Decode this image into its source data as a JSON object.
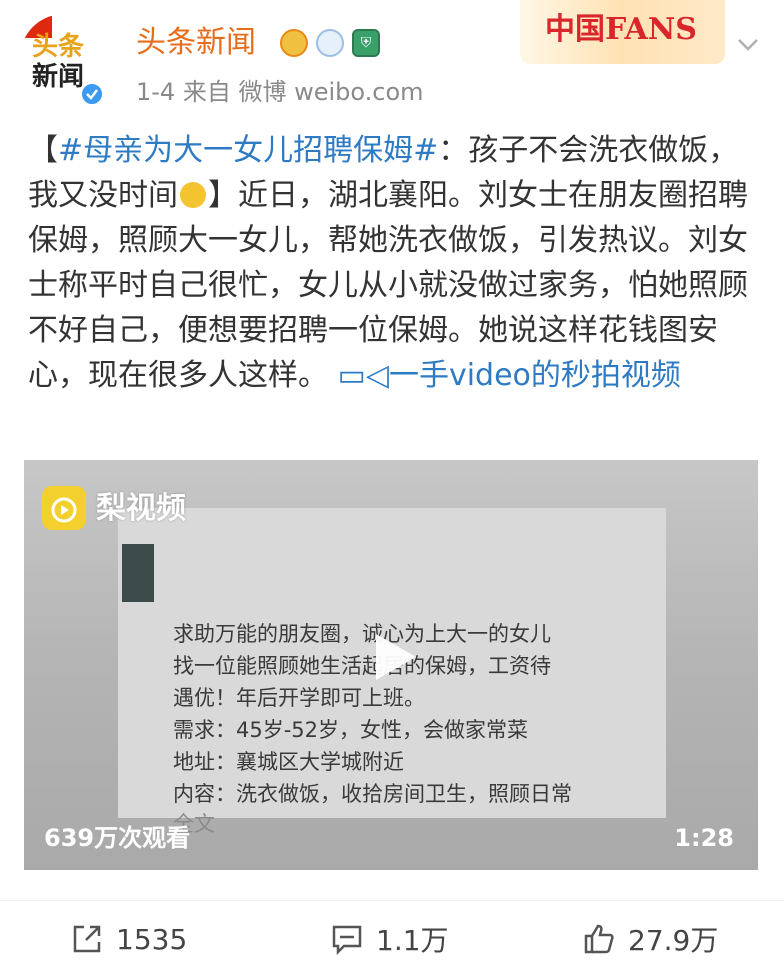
{
  "header": {
    "username": "头条新闻",
    "meta": "1-4  来自 微博 weibo.com",
    "avatar_text_line1": "头条",
    "avatar_text_line2": "新闻",
    "banner_text": "中国FANS"
  },
  "post": {
    "bracket_open": "【",
    "hashtag": "#母亲为大一女儿招聘保姆#",
    "text1": "：孩子不会洗衣做饭，我又没时间",
    "text2": "】近日，湖北襄阳。刘女士在朋友圈招聘保姆，照顾大一女儿，帮她洗衣做饭，引发热议。刘女士称平时自己很忙，女儿从小就没做过家务，怕她照顾不好自己，便想要招聘一位保姆。她说这样花钱图安心，现在很多人这样。",
    "video_link": "一手video的秒拍视频"
  },
  "video": {
    "logo_text": "梨视频",
    "screen_lines": [
      "求助万能的朋友圈，诚心为上大一的女儿",
      "找一位能照顾她生活起居的保姆，工资待",
      "遇优！年后开学即可上班。",
      "需求：45岁-52岁，女性，会做家常菜",
      "地址：襄城区大学城附近",
      "内容：洗衣做饭，收拾房间卫生，照顾日常"
    ],
    "screen_more": "全文",
    "views": "639万次观看",
    "duration": "1:28"
  },
  "actions": {
    "repost_count": "1535",
    "comment_count": "1.1万",
    "like_count": "27.9万"
  },
  "colors": {
    "accent_orange": "#e86d1a",
    "link_blue": "#2e7bc4"
  },
  "icons": [
    "verified-icon",
    "chevron-down-icon",
    "play-icon",
    "repost-icon",
    "comment-icon",
    "like-icon",
    "video-link-icon"
  ]
}
